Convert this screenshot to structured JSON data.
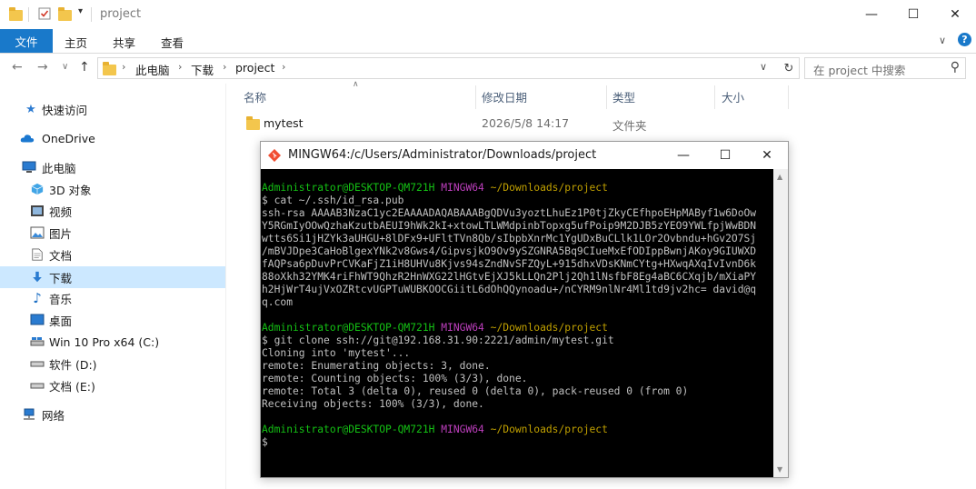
{
  "window": {
    "title": "project",
    "controls": {
      "minimize": "—",
      "maximize": "☐",
      "close": "✕"
    }
  },
  "ribbon": {
    "tabs": [
      "文件",
      "主页",
      "共享",
      "查看"
    ],
    "expand_glyph": "∨",
    "help_glyph": "?"
  },
  "address": {
    "breadcrumbs": [
      "此电脑",
      "下载",
      "project"
    ],
    "search_placeholder": "在 project 中搜索"
  },
  "sidebar": {
    "items": [
      {
        "label": "快速访问",
        "icon": "star-icon"
      },
      {
        "label": "OneDrive",
        "icon": "cloud-icon"
      },
      {
        "label": "此电脑",
        "icon": "computer-icon"
      },
      {
        "label": "3D 对象",
        "icon": "cube-icon"
      },
      {
        "label": "视频",
        "icon": "video-icon"
      },
      {
        "label": "图片",
        "icon": "picture-icon"
      },
      {
        "label": "文档",
        "icon": "document-icon"
      },
      {
        "label": "下载",
        "icon": "download-icon",
        "selected": true
      },
      {
        "label": "音乐",
        "icon": "music-icon"
      },
      {
        "label": "桌面",
        "icon": "desktop-icon"
      },
      {
        "label": "Win 10 Pro x64 (C:)",
        "icon": "drive-icon"
      },
      {
        "label": "软件 (D:)",
        "icon": "drive-icon"
      },
      {
        "label": "文档 (E:)",
        "icon": "drive-icon"
      },
      {
        "label": "网络",
        "icon": "network-icon"
      }
    ]
  },
  "filelist": {
    "columns": [
      "名称",
      "修改日期",
      "类型",
      "大小"
    ],
    "rows": [
      {
        "name": "mytest",
        "date": "2026/5/8 14:17",
        "type": "文件夹",
        "size": ""
      }
    ]
  },
  "terminal": {
    "title": "MINGW64:/c/Users/Administrator/Downloads/project",
    "prompt_user": "Administrator@DESKTOP-QM721H",
    "prompt_sys": "MINGW64",
    "prompt_path": "~/Downloads/project",
    "lines": [
      "$ cat ~/.ssh/id_rsa.pub",
      "ssh-rsa AAAAB3NzaC1yc2EAAAADAQABAAABgQDVu3yoztLhuEz1P0tjZkyCEfhpoEHpMAByf1w6DoOw",
      "Y5RGmIyOOwQzhaKzutbAEUI9hWk2kI+xtowLTLWMdpinbTopxg5ufPoip9M2DJB5zYEO9YWLfpjWwBDN",
      "wtts6Si1jHZYk3aUHGU+8lDFx9+UFltTVn8Qb/sIbpbXnrMc1YgUDxBuCLlk1LOr2Ovbndu+hGv2O7Sj",
      "/mBVJDpe3CaHoBlgexYNk2v8Gws4/GipvsjkO9Ov9ySZGNRA5Bq9CIueMxEfODIppBwnjAKoy9GIUWXD",
      "fAQPsa6pDuvPrCVKaFjZ1iH8UHVu8Kjvs94sZndNvSFZQyL+915dhxVDsKNmCYtg+HXwqAXqIvIvnD6k",
      "88oXkh32YMK4riFhWT9QhzR2HnWXG22lHGtvEjXJ5kLLQn2Plj2Qh1lNsfbF8Eg4aBC6CXqjb/mXiaPY",
      "h2HjWrT4ujVxOZRtcvUGPTuWUBKOOCGiitL6dOhQQynoadu+/nCYRM9nlNr4Ml1td9jv2hc= david@q",
      "q.com",
      "$ git clone ssh://git@192.168.31.90:2221/admin/mytest.git",
      "Cloning into 'mytest'...",
      "remote: Enumerating objects: 3, done.",
      "remote: Counting objects: 100% (3/3), done.",
      "remote: Total 3 (delta 0), reused 0 (delta 0), pack-reused 0 (from 0)",
      "Receiving objects: 100% (3/3), done.",
      "$"
    ]
  }
}
